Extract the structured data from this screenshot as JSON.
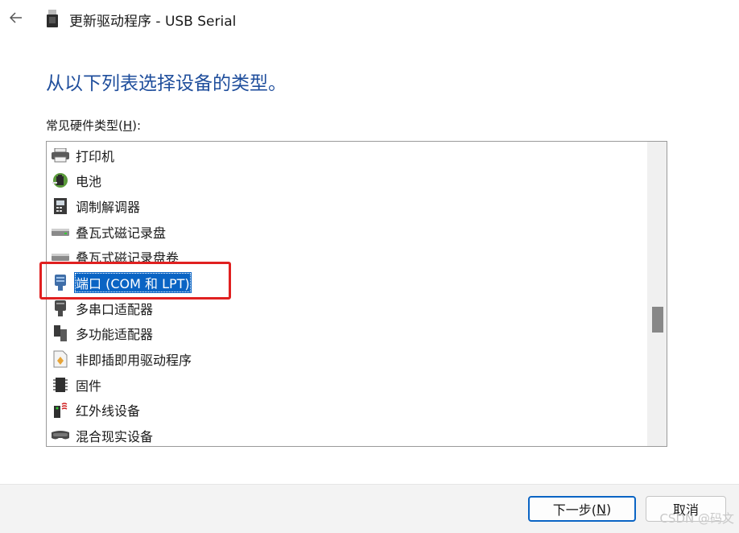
{
  "window": {
    "title": "更新驱动程序 - USB Serial"
  },
  "heading": "从以下列表选择设备的类型。",
  "list": {
    "label_prefix": "常见硬件类型(",
    "label_hotkey": "H",
    "label_suffix": "):",
    "items": [
      {
        "label": "打印机",
        "icon": "printer-icon"
      },
      {
        "label": "电池",
        "icon": "battery-icon"
      },
      {
        "label": "调制解调器",
        "icon": "modem-icon"
      },
      {
        "label": "叠瓦式磁记录盘",
        "icon": "disk-drive-icon"
      },
      {
        "label": "叠瓦式磁记录盘卷",
        "icon": "disk-volume-icon"
      },
      {
        "label": "端口 (COM 和 LPT)",
        "icon": "port-icon",
        "selected": true
      },
      {
        "label": "多串口适配器",
        "icon": "multiport-adapter-icon"
      },
      {
        "label": "多功能适配器",
        "icon": "multifunction-adapter-icon"
      },
      {
        "label": "非即插即用驱动程序",
        "icon": "non-pnp-driver-icon"
      },
      {
        "label": "固件",
        "icon": "firmware-chip-icon"
      },
      {
        "label": "红外线设备",
        "icon": "infrared-device-icon"
      },
      {
        "label": "混合现实设备",
        "icon": "mixed-reality-headset-icon"
      }
    ]
  },
  "footer": {
    "next_prefix": "下一步(",
    "next_hotkey": "N",
    "next_suffix": ")",
    "cancel_label": "取消"
  },
  "watermark": "CSDN @码文",
  "colors": {
    "heading": "#1f4e9c",
    "selection": "#0a64c4",
    "annotation": "#e02020"
  }
}
